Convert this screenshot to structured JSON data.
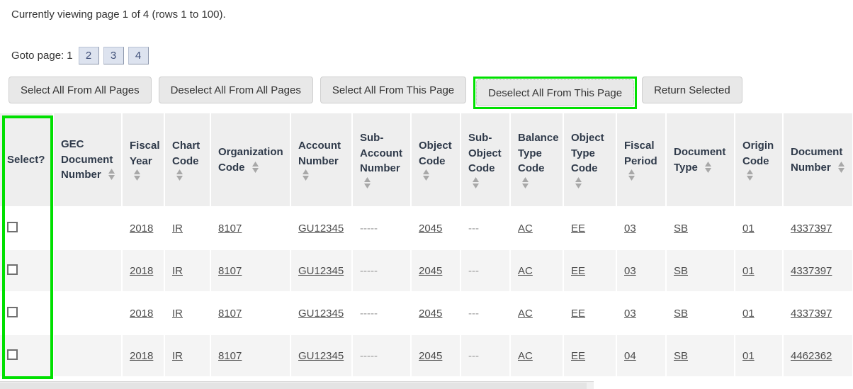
{
  "status": {
    "text": "Currently viewing page 1 of 4 (rows 1 to 100)."
  },
  "pagination": {
    "label": "Goto page:",
    "current_page": "1",
    "pages": [
      "2",
      "3",
      "4"
    ]
  },
  "actions": {
    "select_all_pages": "Select All From All Pages",
    "deselect_all_pages": "Deselect All From All Pages",
    "select_all_this_page": "Select All From This Page",
    "deselect_all_this_page": "Deselect All From This Page",
    "return_selected": "Return Selected",
    "highlighted_button": "Deselect All From This Page",
    "highlight_color": "#00e000"
  },
  "table": {
    "headers": [
      {
        "label": "Select?",
        "sortable": false
      },
      {
        "label": "GEC Document Number",
        "sortable": true
      },
      {
        "label": "Fiscal Year",
        "sortable": true
      },
      {
        "label": "Chart Code",
        "sortable": true
      },
      {
        "label": "Organization Code",
        "sortable": true
      },
      {
        "label": "Account Number",
        "sortable": true
      },
      {
        "label": "Sub-Account Number",
        "sortable": true
      },
      {
        "label": "Object Code",
        "sortable": true
      },
      {
        "label": "Sub-Object Code",
        "sortable": true
      },
      {
        "label": "Balance Type Code",
        "sortable": true
      },
      {
        "label": "Object Type Code",
        "sortable": true
      },
      {
        "label": "Fiscal Period",
        "sortable": true
      },
      {
        "label": "Document Type",
        "sortable": true
      },
      {
        "label": "Origin Code",
        "sortable": true
      },
      {
        "label": "Document Number",
        "sortable": true
      }
    ],
    "rows": [
      {
        "checked": false,
        "gec_document_number": "",
        "fiscal_year": "2018",
        "chart_code": "IR",
        "organization_code": "8107",
        "account_number": "GU12345",
        "sub_account_number": "-----",
        "object_code": "2045",
        "sub_object_code": "---",
        "balance_type_code": "AC",
        "object_type_code": "EE",
        "fiscal_period": "03",
        "document_type": "SB",
        "origin_code": "01",
        "document_number": "4337397"
      },
      {
        "checked": false,
        "gec_document_number": "",
        "fiscal_year": "2018",
        "chart_code": "IR",
        "organization_code": "8107",
        "account_number": "GU12345",
        "sub_account_number": "-----",
        "object_code": "2045",
        "sub_object_code": "---",
        "balance_type_code": "AC",
        "object_type_code": "EE",
        "fiscal_period": "03",
        "document_type": "SB",
        "origin_code": "01",
        "document_number": "4337397"
      },
      {
        "checked": false,
        "gec_document_number": "",
        "fiscal_year": "2018",
        "chart_code": "IR",
        "organization_code": "8107",
        "account_number": "GU12345",
        "sub_account_number": "-----",
        "object_code": "2045",
        "sub_object_code": "---",
        "balance_type_code": "AC",
        "object_type_code": "EE",
        "fiscal_period": "03",
        "document_type": "SB",
        "origin_code": "01",
        "document_number": "4337397"
      },
      {
        "checked": false,
        "gec_document_number": "",
        "fiscal_year": "2018",
        "chart_code": "IR",
        "organization_code": "8107",
        "account_number": "GU12345",
        "sub_account_number": "-----",
        "object_code": "2045",
        "sub_object_code": "---",
        "balance_type_code": "AC",
        "object_type_code": "EE",
        "fiscal_period": "04",
        "document_type": "SB",
        "origin_code": "01",
        "document_number": "4462362"
      }
    ]
  }
}
